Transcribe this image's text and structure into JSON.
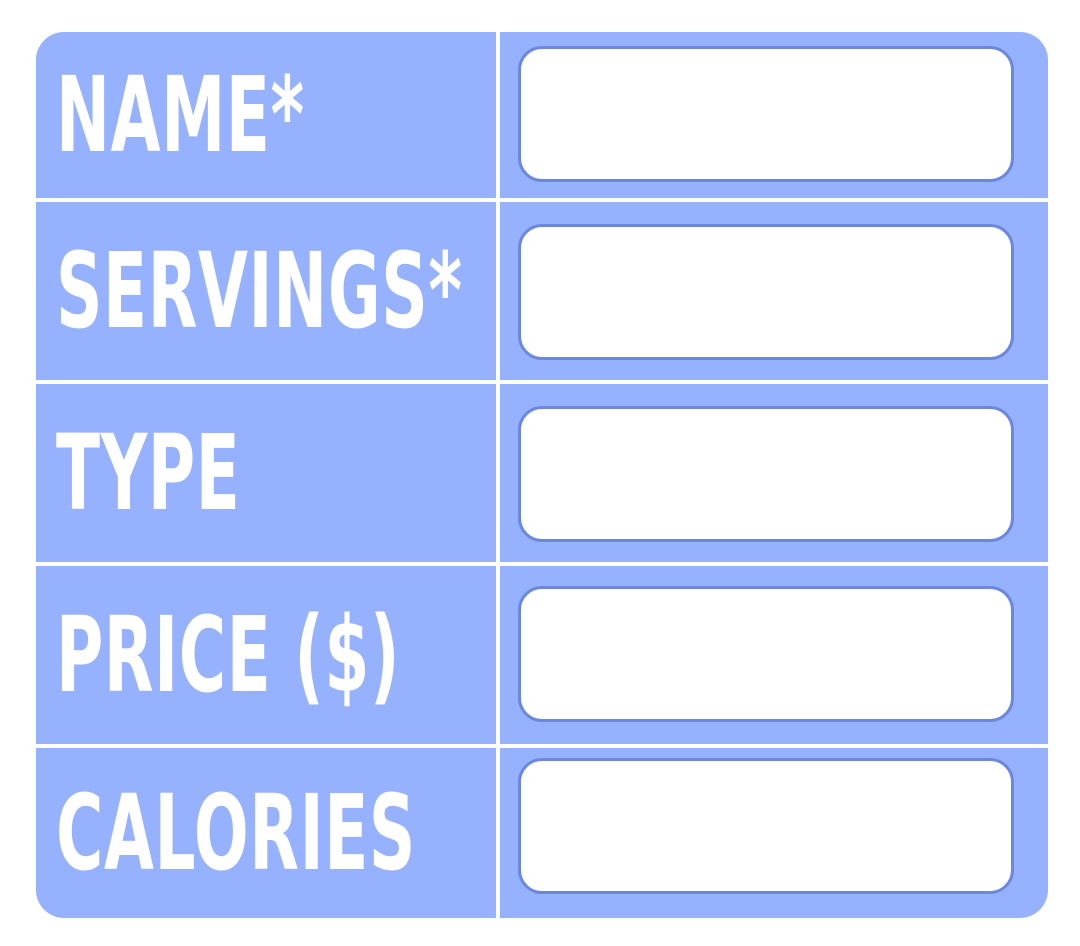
{
  "form": {
    "fields": [
      {
        "label": "NAME*",
        "value": "",
        "placeholder": ""
      },
      {
        "label": "SERVINGS*",
        "value": "",
        "placeholder": ""
      },
      {
        "label": "TYPE",
        "value": "",
        "placeholder": ""
      },
      {
        "label": "PRICE ($)",
        "value": "",
        "placeholder": ""
      },
      {
        "label": "CALORIES",
        "value": "",
        "placeholder": ""
      }
    ]
  },
  "colors": {
    "card_background": "#96b1fe",
    "divider": "#ffffff",
    "input_border": "#6b87de",
    "label_text": "#ffffff"
  }
}
